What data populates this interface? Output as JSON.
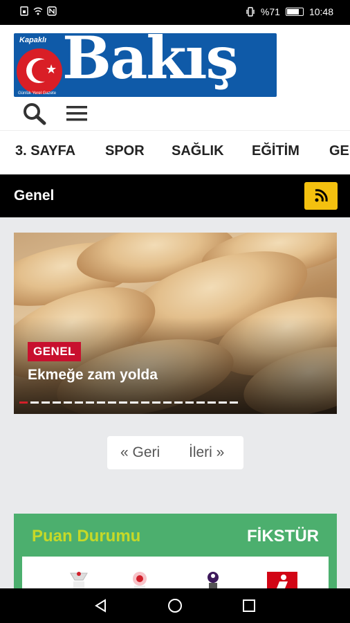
{
  "status_bar": {
    "left_icons": [
      "sim-icon",
      "wifi-icon",
      "nfc-icon"
    ],
    "right_icons": [
      "vibrate-icon"
    ],
    "battery": "%71",
    "time": "10:48"
  },
  "header": {
    "logo": {
      "name": "Bakış",
      "prefix": "Kapaklı",
      "tagline": "Günlük Yerel Gazete"
    },
    "search_icon": "search-icon",
    "menu_icon": "menu-icon"
  },
  "nav": {
    "items": [
      "3. SAYFA",
      "SPOR",
      "SAĞLIK",
      "EĞİTİM",
      "GE"
    ]
  },
  "section": {
    "title": "Genel",
    "rss_icon": "rss-icon"
  },
  "slider": {
    "category": "GENEL",
    "headline": "Ekmeğe zam yolda",
    "total_slides": 20,
    "active_slide": 1
  },
  "pager": {
    "prev": "« Geri",
    "next": "İleri »"
  },
  "scores": {
    "tab_standings": "Puan Durumu",
    "tab_fixtures": "FİKSTÜR",
    "leagues": [
      "super-lig-icon",
      "tff-icon",
      "premier-league-icon",
      "bundesliga-icon"
    ]
  },
  "colors": {
    "logo_blue": "#0f5aa8",
    "badge_red": "#c8102e",
    "rss_yellow": "#f4c10f",
    "scores_green": "#4caf6e",
    "tab_active": "#c6d928"
  }
}
